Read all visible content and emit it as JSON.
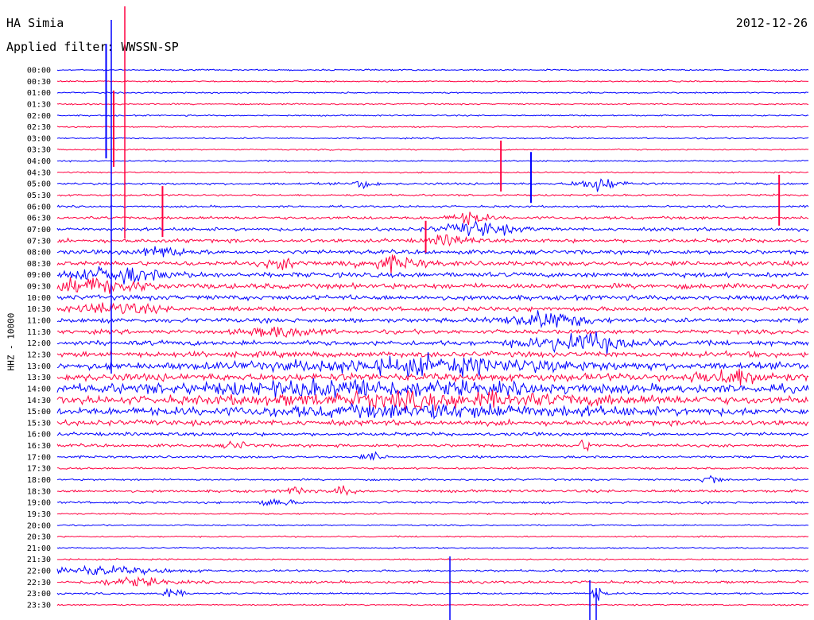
{
  "header": {
    "station": "HA Simia",
    "date": "2012-12-26",
    "filter": "Applied filter: WWSSN-SP"
  },
  "chart_data": {
    "type": "line",
    "title": "HA Simia",
    "date": "2012-12-26",
    "filter": "WWSSN-SP",
    "ylabel": "HHZ - 10000",
    "xlabel": "",
    "y_tick_labels": [
      "00:00",
      "00:30",
      "01:00",
      "01:30",
      "02:00",
      "02:30",
      "03:00",
      "03:30",
      "04:00",
      "04:30",
      "05:00",
      "05:30",
      "06:00",
      "06:30",
      "07:00",
      "07:30",
      "08:00",
      "08:30",
      "09:00",
      "09:30",
      "10:00",
      "10:30",
      "11:00",
      "11:30",
      "12:00",
      "12:30",
      "13:00",
      "13:30",
      "14:00",
      "14:30",
      "15:00",
      "15:30",
      "16:00",
      "16:30",
      "17:00",
      "17:30",
      "18:00",
      "18:30",
      "19:00",
      "19:30",
      "20:00",
      "20:30",
      "21:00",
      "21:30",
      "22:00",
      "22:30",
      "23:00",
      "23:30"
    ],
    "series_colors": [
      "#0000ff",
      "#ff0040"
    ],
    "grid": false,
    "legend": "none",
    "line_amplitude_relative": [
      0.15,
      0.12,
      0.18,
      0.25,
      0.15,
      0.2,
      0.18,
      0.35,
      0.25,
      0.3,
      0.6,
      0.5,
      0.55,
      0.8,
      0.9,
      1.0,
      1.1,
      1.2,
      1.3,
      1.4,
      1.3,
      1.2,
      1.2,
      1.1,
      1.3,
      1.5,
      1.8,
      2.0,
      2.2,
      2.0,
      1.9,
      1.4,
      0.9,
      0.8,
      0.6,
      0.5,
      0.5,
      0.7,
      0.6,
      0.4,
      0.3,
      0.3,
      0.35,
      0.35,
      0.6,
      0.7,
      0.5,
      0.35
    ]
  }
}
